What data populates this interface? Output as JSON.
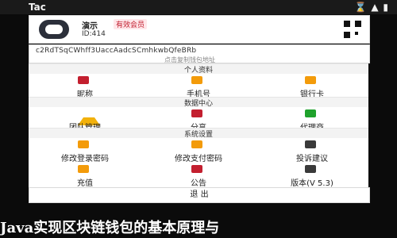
{
  "status_bar": {
    "app_name": "Tac",
    "right_icons": "⌛ ▲ ▮"
  },
  "profile": {
    "name": "演示",
    "tag": "有效会员",
    "uid": "ID:414"
  },
  "wallet": {
    "address": "c2RdTSqCWhff3UaccAadcSCmhkwbQfeBRb",
    "copy_tip": "点击复制钱包地址"
  },
  "sections": {
    "personal": "个人资料",
    "data": "数据中心",
    "system": "系统设置"
  },
  "personal_items": [
    {
      "label": "昵称",
      "icon": "person-icon"
    },
    {
      "label": "手机号",
      "icon": "phone-icon"
    },
    {
      "label": "银行卡",
      "icon": "card-icon"
    }
  ],
  "data_items": [
    {
      "label": "团队管理",
      "icon": "crown-icon"
    },
    {
      "label": "分享",
      "icon": "share-icon"
    },
    {
      "label": "代理商",
      "icon": "agent-icon"
    }
  ],
  "system_items_row1": [
    {
      "label": "修改登录密码",
      "icon": "lock-icon"
    },
    {
      "label": "修改支付密码",
      "icon": "key-icon"
    },
    {
      "label": "投诉建议",
      "icon": "complaint-icon"
    }
  ],
  "system_items_row2": [
    {
      "label": "充值",
      "icon": "recharge-icon"
    },
    {
      "label": "公告",
      "icon": "announcement-icon"
    },
    {
      "label": "版本(V 5.3)",
      "icon": "version-icon"
    }
  ],
  "logout": "退 出",
  "bottom_banner": "Java实现区块链钱包的基本原理与"
}
